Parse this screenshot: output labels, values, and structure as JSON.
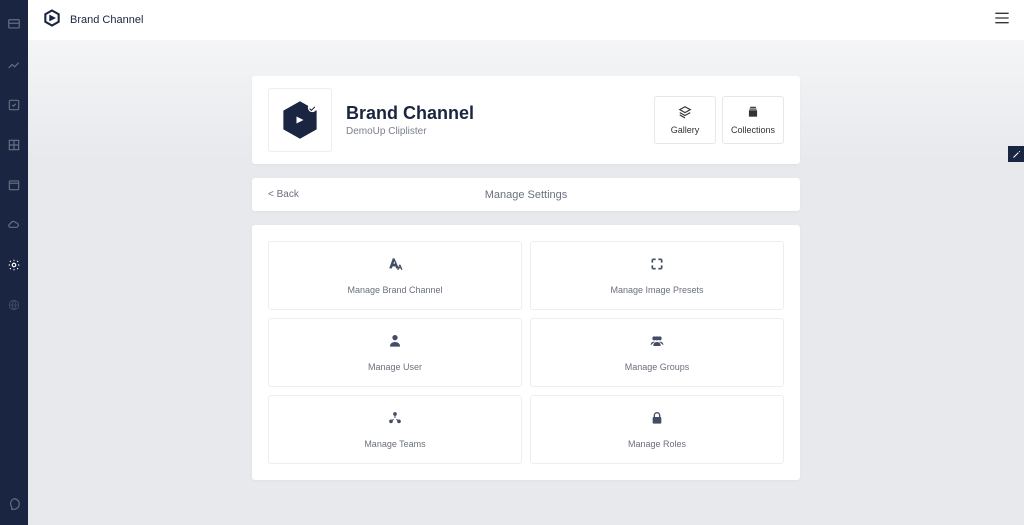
{
  "brand": {
    "name": "Brand Channel"
  },
  "header": {
    "title": "Brand Channel",
    "subtitle": "DemoUp Cliplister",
    "buttons": {
      "gallery": "Gallery",
      "collections": "Collections"
    }
  },
  "breadcrumb": {
    "back": "< Back",
    "title": "Manage Settings"
  },
  "tiles": {
    "brandChannel": "Manage Brand Channel",
    "imagePresets": "Manage Image Presets",
    "user": "Manage User",
    "groups": "Manage Groups",
    "teams": "Manage Teams",
    "roles": "Manage Roles"
  }
}
